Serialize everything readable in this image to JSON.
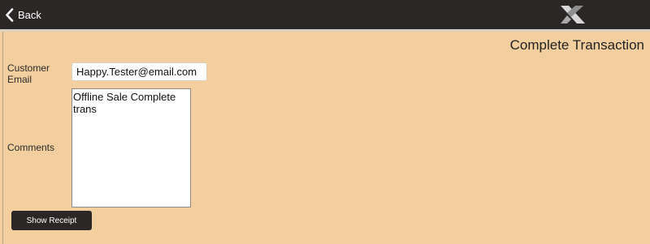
{
  "header": {
    "back_label": "Back",
    "back_icon": "chevron-left-icon",
    "logo_icon": "x-logo-icon",
    "colors": {
      "bar": "#2b2726",
      "panel": "#f3cf9f"
    }
  },
  "page": {
    "title": "Complete Transaction"
  },
  "form": {
    "email_label": "Customer Email",
    "email_value": "Happy.Tester@email.com",
    "comments_label": "Comments",
    "comments_value": "Offline Sale Complete trans",
    "show_receipt_label": "Show Receipt"
  }
}
